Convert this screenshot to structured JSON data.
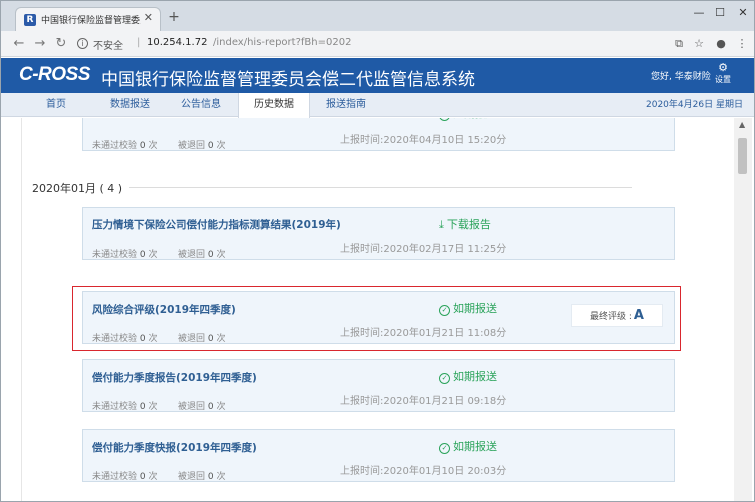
{
  "browser": {
    "tab_title": "中国银行保险监督管理委员会",
    "tab_favicon": "R",
    "security_label": "不安全",
    "url_host": "10.254.1.72",
    "url_path": "/index/his-report?fBh=0202"
  },
  "site": {
    "logo": "C-ROSS",
    "title": "中国银行保险监督管理委员会偿二代监管信息系统",
    "user": "您好, 华泰财险",
    "settings_label": "设置"
  },
  "nav": {
    "items": [
      "首页",
      "数据报送",
      "公告信息",
      "历史数据",
      "报送指南"
    ],
    "active_index": 3,
    "date": "2020年4月26日 星期日"
  },
  "content": {
    "top_card": {
      "fail_label": "未通过校验",
      "fail_count": "0",
      "return_label": "被退回",
      "return_count": "0",
      "unit": "次",
      "time": "上报时间:2020年04月10日 15:20分"
    },
    "month_heading": "2020年01月 ( 4 )",
    "cards": [
      {
        "title": "压力情境下保险公司偿付能力指标测算结果(2019年)",
        "status": "下载报告",
        "status_icon": "download-icon",
        "fail_label": "未通过校验",
        "fail_count": "0",
        "return_label": "被退回",
        "return_count": "0",
        "unit": "次",
        "time": "上报时间:2020年02月17日 11:25分"
      },
      {
        "title": "风险综合评级(2019年四季度)",
        "status": "如期报送",
        "status_icon": "check-circle-icon",
        "fail_label": "未通过校验",
        "fail_count": "0",
        "return_label": "被退回",
        "return_count": "0",
        "unit": "次",
        "time": "上报时间:2020年01月21日 11:08分",
        "grade_label": "最终评级 :",
        "grade": "A"
      },
      {
        "title": "偿付能力季度报告(2019年四季度)",
        "status": "如期报送",
        "status_icon": "check-circle-icon",
        "fail_label": "未通过校验",
        "fail_count": "0",
        "return_label": "被退回",
        "return_count": "0",
        "unit": "次",
        "time": "上报时间:2020年01月21日 09:18分"
      },
      {
        "title": "偿付能力季度快报(2019年四季度)",
        "status": "如期报送",
        "status_icon": "check-circle-icon",
        "fail_label": "未通过校验",
        "fail_count": "0",
        "return_label": "被退回",
        "return_count": "0",
        "unit": "次",
        "time": "上报时间:2020年01月10日 20:03分"
      }
    ]
  },
  "colors": {
    "header_blue": "#1f5aa6",
    "status_green": "#2aa35a",
    "highlight_red": "#d9272e"
  }
}
